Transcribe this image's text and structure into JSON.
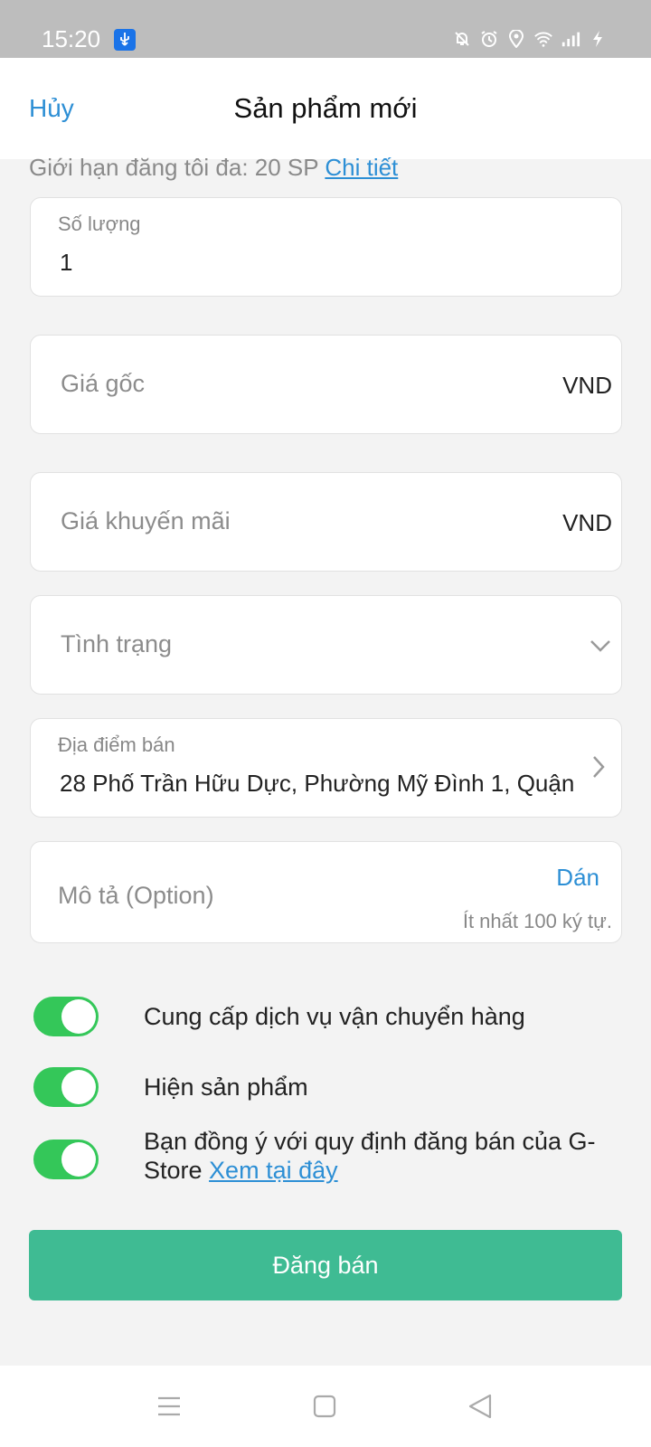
{
  "status_bar": {
    "time": "15:20",
    "icons": [
      "usb-icon",
      "mute-bell-icon",
      "alarm-icon",
      "location-icon",
      "wifi-icon",
      "signal-icon",
      "charging-icon"
    ]
  },
  "header": {
    "cancel_label": "Hủy",
    "title": "Sản phẩm mới"
  },
  "limit": {
    "text": "Giới hạn đăng tôi đa: 20 SP ",
    "detail_link": "Chi tiết"
  },
  "form": {
    "quantity": {
      "label": "Số lượng",
      "value": "1"
    },
    "original_price": {
      "placeholder": "Giá gốc",
      "unit": "VND"
    },
    "sale_price": {
      "placeholder": "Giá khuyến mãi",
      "unit": "VND"
    },
    "condition": {
      "placeholder": "Tình trạng"
    },
    "location": {
      "label": "Địa điểm bán",
      "value": "28 Phố Trần Hữu Dực, Phường Mỹ Đình 1, Quận"
    },
    "description": {
      "placeholder": "Mô tả (Option)",
      "paste_label": "Dán",
      "hint": "Ít nhất 100 ký tự."
    }
  },
  "toggles": [
    {
      "label": "Cung cấp dịch vụ vận chuyển hàng",
      "on": true
    },
    {
      "label": "Hiện sản phẩm",
      "on": true
    },
    {
      "label": "Bạn đồng ý với quy định đăng bán của G-Store ",
      "link": "Xem tại đây",
      "on": true
    }
  ],
  "submit_label": "Đăng bán",
  "colors": {
    "accent": "#2d8fd5",
    "toggle_on": "#34c759",
    "submit": "#3fbb93",
    "status_bar": "#bdbdbd"
  }
}
